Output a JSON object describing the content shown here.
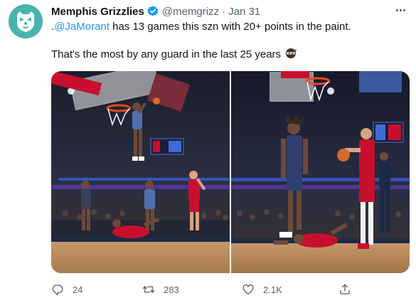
{
  "tweet": {
    "author_name": "Memphis Grizzlies",
    "handle": "@memgrizz",
    "separator": "·",
    "date": "Jan 31",
    "line1_prefix": ".",
    "mention": "@JaMorant",
    "line1_rest": " has 13 games this szn with 20+ points in the paint.",
    "line2": "That's the most by any guard in the last 25 years",
    "line2_emoji": "ninja"
  },
  "actions": {
    "reply_count": "24",
    "retweet_count": "283",
    "like_count": "2.1K"
  },
  "icons": {
    "avatar": "grizzlies-logo-icon",
    "verified": "verified-badge-icon",
    "more": "more-options-icon",
    "reply": "reply-icon",
    "retweet": "retweet-icon",
    "like": "heart-icon",
    "share": "share-icon"
  },
  "colors": {
    "accent": "#1d9bf0",
    "avatar_bg": "#4ab3ae",
    "muted": "#536471",
    "text": "#0f1419"
  }
}
